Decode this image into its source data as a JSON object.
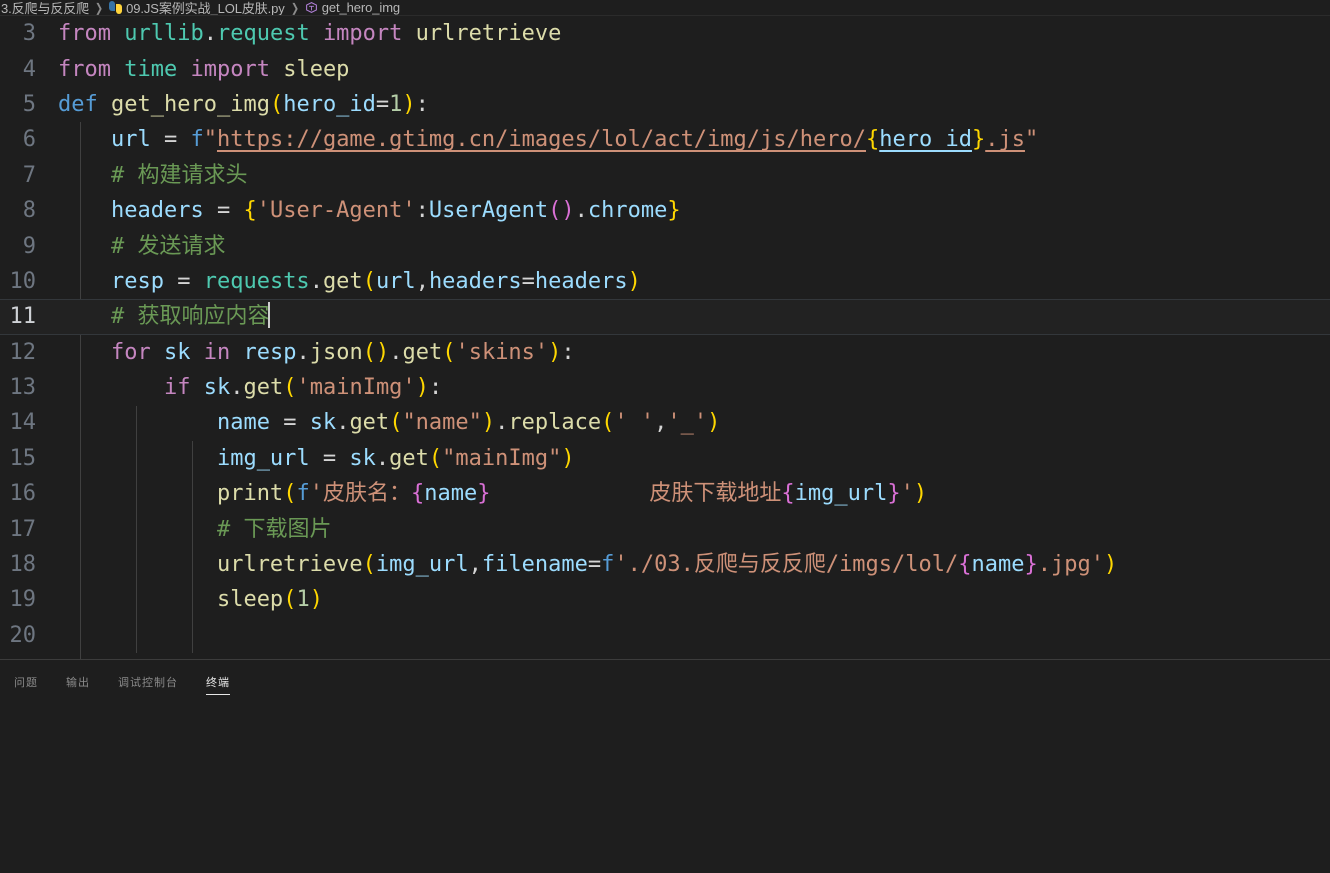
{
  "window": {
    "app": "vscode-editor",
    "background": "#1e1e1e"
  },
  "breadcrumb": {
    "items": [
      {
        "label": "3.反爬与反反爬",
        "icon": ""
      },
      {
        "label": "09.JS案例实战_LOL皮肤.py",
        "icon": "python-file-icon"
      },
      {
        "label": "get_hero_img",
        "icon": "method-symbol-icon"
      }
    ],
    "separator": "❯"
  },
  "editor": {
    "active_line": 11,
    "cursor_after": "# 获取响应内容",
    "lines": [
      {
        "n": "3",
        "text": "from urllib.request import urlretrieve"
      },
      {
        "n": "4",
        "text": "from time import sleep"
      },
      {
        "n": "5",
        "text": "def get_hero_img(hero_id=1):"
      },
      {
        "n": "6",
        "text": "    url = f\"https://game.gtimg.cn/images/lol/act/img/js/hero/{hero_id}.js\""
      },
      {
        "n": "7",
        "text": "    # 构建请求头"
      },
      {
        "n": "8",
        "text": "    headers = {'User-Agent':UserAgent().chrome}"
      },
      {
        "n": "9",
        "text": "    # 发送请求"
      },
      {
        "n": "10",
        "text": "    resp = requests.get(url,headers=headers)"
      },
      {
        "n": "11",
        "text": "    # 获取响应内容"
      },
      {
        "n": "12",
        "text": "    for sk in resp.json().get('skins'):"
      },
      {
        "n": "13",
        "text": "        if sk.get('mainImg'):"
      },
      {
        "n": "14",
        "text": "            name = sk.get(\"name\").replace(' ','_')"
      },
      {
        "n": "15",
        "text": "            img_url = sk.get(\"mainImg\")"
      },
      {
        "n": "16",
        "text": "            print(f'皮肤名：{name}            皮肤下载地址{img_url}')"
      },
      {
        "n": "17",
        "text": "            # 下载图片"
      },
      {
        "n": "18",
        "text": "            urlretrieve(img_url,filename=f'./03.反爬与反反爬/imgs/lol/{name}.jpg')"
      },
      {
        "n": "19",
        "text": "            sleep(1)"
      },
      {
        "n": "20",
        "text": ""
      }
    ],
    "tokens": {
      "line3": {
        "kw1": "from",
        "mod": "urllib",
        "dot": ".",
        "sub": "request",
        "kw2": "import",
        "fn": "urlretrieve"
      },
      "line4": {
        "kw1": "from",
        "mod": "time",
        "kw2": "import",
        "fn": "sleep"
      },
      "line5": {
        "kw": "def",
        "name": "get_hero_img",
        "param": "hero_id",
        "eq": "=",
        "num": "1",
        "colon": ":"
      },
      "line6": {
        "var": "url",
        "eq": "=",
        "f": "f",
        "url": "https://game.gtimg.cn/images/lol/act/img/js/hero/",
        "interp": "hero_id",
        "tail": ".js"
      },
      "line7": {
        "comment": "# 构建请求头"
      },
      "line8": {
        "var": "headers",
        "eq": "=",
        "key": "'User-Agent'",
        "cls": "UserAgent",
        "attr": "chrome"
      },
      "line9": {
        "comment": "# 发送请求"
      },
      "line10": {
        "var": "resp",
        "eq": "=",
        "mod": "requests",
        "fn": "get",
        "a1": "url",
        "a2": "headers",
        "a3": "headers"
      },
      "line11": {
        "comment": "# 获取响应内容"
      },
      "line12": {
        "kw1": "for",
        "v": "sk",
        "kw2": "in",
        "obj": "resp",
        "m1": "json",
        "m2": "get",
        "str": "'skins'"
      },
      "line13": {
        "kw": "if",
        "obj": "sk",
        "m": "get",
        "str": "'mainImg'"
      },
      "line14": {
        "var": "name",
        "obj": "sk",
        "m1": "get",
        "s1": "\"name\"",
        "m2": "replace",
        "s2": "' '",
        "s3": "'_'"
      },
      "line15": {
        "var": "img_url",
        "obj": "sk",
        "m": "get",
        "s": "\"mainImg\""
      },
      "line16": {
        "fn": "print",
        "f": "f",
        "txt1": "皮肤名：",
        "i1": "name",
        "gap": "            ",
        "txt2": "皮肤下载地址",
        "i2": "img_url"
      },
      "line17": {
        "comment": "# 下载图片"
      },
      "line18": {
        "fn": "urlretrieve",
        "a1": "img_url",
        "kwarg": "filename",
        "f": "f",
        "path1": "./03.反爬与反反爬/imgs/lol/",
        "i1": "name",
        "path2": ".jpg"
      },
      "line19": {
        "fn": "sleep",
        "num": "1"
      }
    }
  },
  "panel": {
    "tabs": [
      {
        "label": "问题",
        "active": false
      },
      {
        "label": "输出",
        "active": false
      },
      {
        "label": "调试控制台",
        "active": false
      },
      {
        "label": "终端",
        "active": true
      }
    ],
    "terminal_content": ""
  },
  "colors": {
    "background": "#1e1e1e",
    "active_line": "#222222",
    "keyword": "#C586C0",
    "function": "#DCDCAA",
    "variable": "#9CDCFE",
    "string": "#CE9178",
    "comment": "#6A9955",
    "number": "#B5CEA8",
    "bracket_yellow": "#FFD700",
    "bracket_magenta": "#DA70D6",
    "bracket_blue": "#179FFF",
    "module": "#4EC9B0",
    "def_keyword": "#569CD6"
  }
}
